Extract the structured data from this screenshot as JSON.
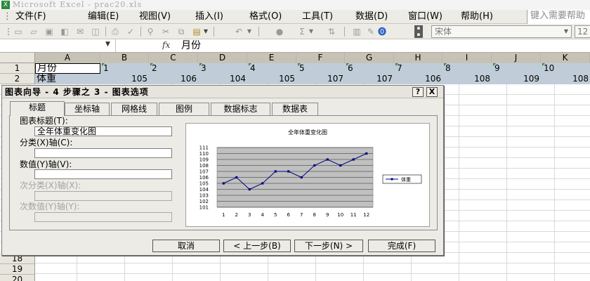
{
  "window": {
    "title": "Microsoft Excel - prac20.xls",
    "app_icon": "excel-icon"
  },
  "menu": [
    "文件(F)",
    "编辑(E)",
    "视图(V)",
    "插入(I)",
    "格式(O)",
    "工具(T)",
    "数据(D)",
    "窗口(W)",
    "帮助(H)"
  ],
  "help_search": {
    "placeholder": "键入需要帮助"
  },
  "toolbar": {
    "font_name": "宋体",
    "font_size": "12"
  },
  "formula_bar": {
    "name_box": "",
    "fx_label": "fx",
    "content": "月份"
  },
  "columns": [
    "A",
    "B",
    "C",
    "D",
    "E",
    "F",
    "G",
    "H",
    "I",
    "J",
    "K"
  ],
  "rows": {
    "row1": {
      "num": "1",
      "label": "月份",
      "values": [
        "1",
        "2",
        "3",
        "4",
        "5",
        "6",
        "7",
        "8",
        "9",
        "10"
      ]
    },
    "row2": {
      "num": "2",
      "label": "体重",
      "values": [
        "105",
        "106",
        "104",
        "105",
        "107",
        "107",
        "106",
        "108",
        "109",
        "108"
      ]
    }
  },
  "lower_rows": [
    "18",
    "19",
    "20"
  ],
  "dialog": {
    "title": "图表向导 - 4 步骤之 3 - 图表选项",
    "help_button": "?",
    "close_button": "X",
    "tabs": [
      "标题",
      "坐标轴",
      "网格线",
      "图例",
      "数据标志",
      "数据表"
    ],
    "fields": {
      "chart_title_label": "图表标题(T):",
      "chart_title_value": "全年体重变化图",
      "category_x_label": "分类(X)轴(C):",
      "category_x_value": "",
      "value_y_label": "数值(Y)轴(V):",
      "value_y_value": "",
      "secondary_x_label": "次分类(X)轴(X):",
      "secondary_y_label": "次数值(Y)轴(Y):"
    },
    "buttons": {
      "cancel": "取消",
      "back": "< 上一步(B)",
      "next": "下一步(N) >",
      "finish": "完成(F)"
    }
  },
  "chart_data": {
    "type": "line",
    "title": "全年体重变化图",
    "x": [
      1,
      2,
      3,
      4,
      5,
      6,
      7,
      8,
      9,
      10,
      11,
      12
    ],
    "series": [
      {
        "name": "体重",
        "values": [
          105,
          106,
          104,
          105,
          107,
          107,
          106,
          108,
          109,
          108,
          109,
          110
        ]
      }
    ],
    "ylim": [
      101,
      111
    ],
    "yticks": [
      101,
      102,
      103,
      104,
      105,
      106,
      107,
      108,
      109,
      110,
      111
    ],
    "grid": true,
    "legend": "right",
    "plot_area_color": "#c0c0c0",
    "line_color": "#00007f"
  }
}
